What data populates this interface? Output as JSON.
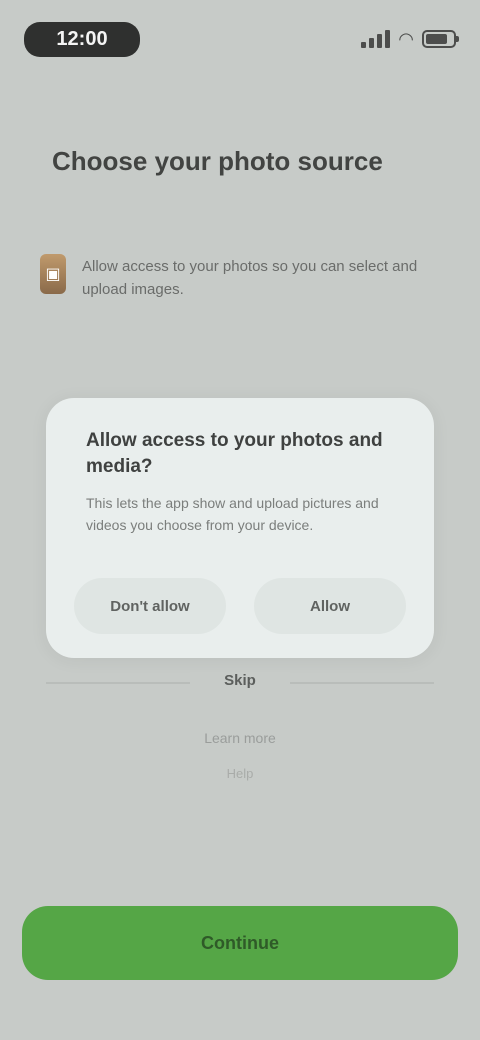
{
  "status_bar": {
    "time": "12:00"
  },
  "header": {
    "title": "Choose your photo source"
  },
  "info": {
    "icon": "photo-icon",
    "text": "Allow access to your photos so you can select and upload images."
  },
  "dialog": {
    "title": "Allow access to your photos and media?",
    "body": "This lets the app show and upload pictures and videos you choose from your device.",
    "deny_label": "Don't allow",
    "allow_label": "Allow"
  },
  "background_links": {
    "link_1": "Skip",
    "link_2": "Learn more",
    "link_3": "Help"
  },
  "primary_button": {
    "label": "Continue"
  },
  "colors": {
    "background": "#c7cbc8",
    "dialog": "#e9eeed",
    "accent_green": "#55a646"
  }
}
